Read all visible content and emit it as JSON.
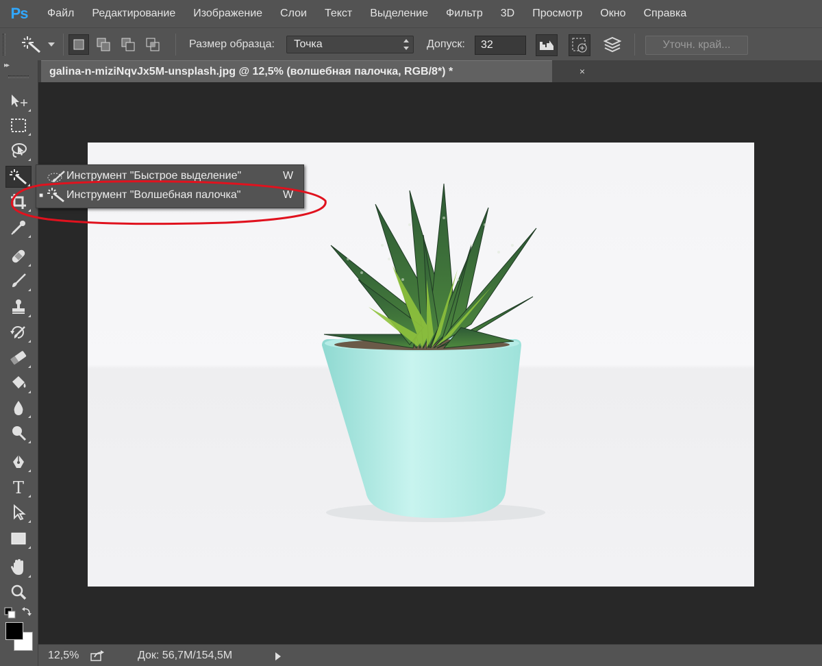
{
  "app": {
    "logo": "Ps",
    "menu": [
      "Файл",
      "Редактирование",
      "Изображение",
      "Слои",
      "Текст",
      "Выделение",
      "Фильтр",
      "3D",
      "Просмотр",
      "Окно",
      "Справка"
    ]
  },
  "options": {
    "sample_size_label": "Размер образца:",
    "sample_size_value": "Точка",
    "tolerance_label": "Допуск:",
    "tolerance_value": "32",
    "refine_edge_label": "Уточн. край..."
  },
  "document": {
    "tab_title": "galina-n-miziNqvJx5M-unsplash.jpg @ 12,5% (волшебная палочка, RGB/8*) *",
    "close_glyph": "×"
  },
  "flyout": {
    "items": [
      {
        "label": "Инструмент \"Быстрое выделение\"",
        "shortcut": "W",
        "icon": "quick-selection-icon",
        "active": false
      },
      {
        "label": "Инструмент \"Волшебная палочка\"",
        "shortcut": "W",
        "icon": "magic-wand-icon",
        "active": true
      }
    ],
    "active_bullet": "■"
  },
  "status": {
    "zoom": "12,5%",
    "doc_info": "Док: 56,7M/154,5M"
  },
  "colors": {
    "foreground": "#000000",
    "background": "#ffffff",
    "annotation": "#e0121e",
    "pot": "#a9e7e0"
  }
}
